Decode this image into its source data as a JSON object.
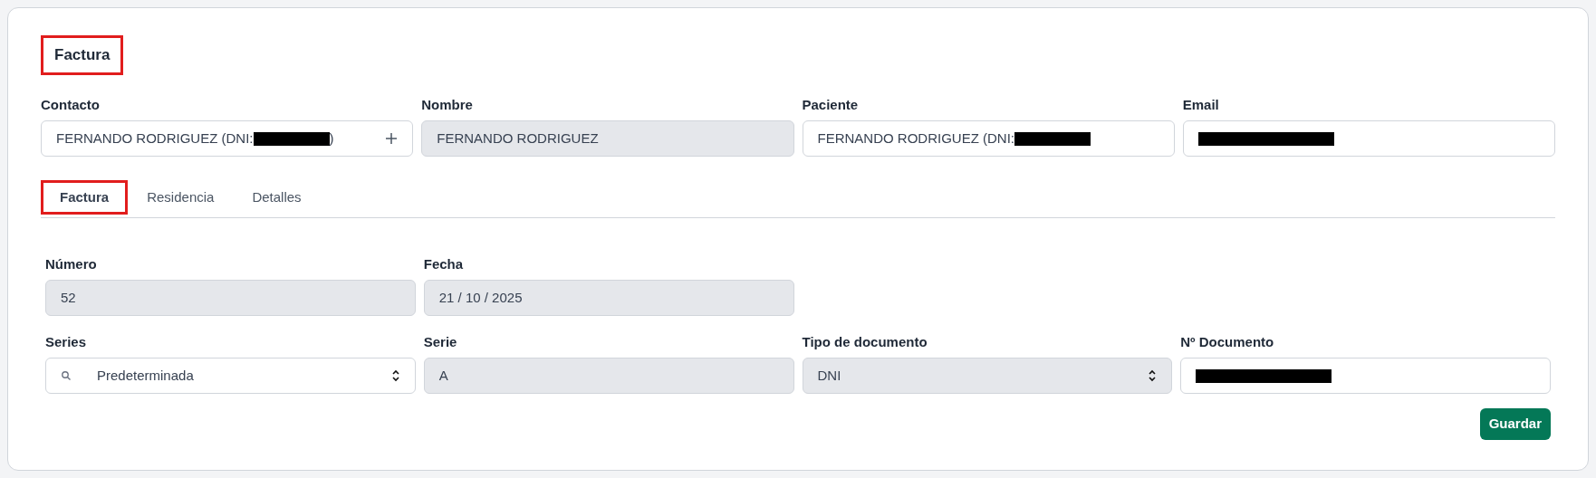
{
  "title": {
    "text": "Factura",
    "highlighted": true
  },
  "contact_fields": [
    {
      "label": "Contacto",
      "kind": "lookup",
      "value": "FERNANDO RODRIGUEZ (DNI:",
      "redacted": true,
      "value_after": ")"
    },
    {
      "label": "Nombre",
      "kind": "readonly",
      "value": "FERNANDO RODRIGUEZ"
    },
    {
      "label": "Paciente",
      "kind": "input",
      "value": "FERNANDO RODRIGUEZ (DNI:",
      "redacted": true
    },
    {
      "label": "Email",
      "kind": "input",
      "redacted": true
    }
  ],
  "tabs": [
    {
      "label": "Factura",
      "selected": true,
      "highlighted": true
    },
    {
      "label": "Residencia",
      "selected": false,
      "highlighted": false
    },
    {
      "label": "Detalles",
      "selected": false,
      "highlighted": false
    }
  ],
  "invoice_rows": [
    [
      {
        "label": "Número",
        "kind": "readonly",
        "value": "52"
      },
      {
        "label": "Fecha",
        "kind": "readonly",
        "value": "21 / 10 / 2025"
      }
    ],
    [
      {
        "label": "Series",
        "kind": "search-select",
        "value": "Predeterminada"
      },
      {
        "label": "Serie",
        "kind": "readonly",
        "value": "A"
      },
      {
        "label": "Tipo de documento",
        "kind": "readonly-select",
        "value": "DNI"
      },
      {
        "label": "Nº Documento",
        "kind": "input",
        "redacted": true
      }
    ]
  ],
  "save_button": "Guardar"
}
